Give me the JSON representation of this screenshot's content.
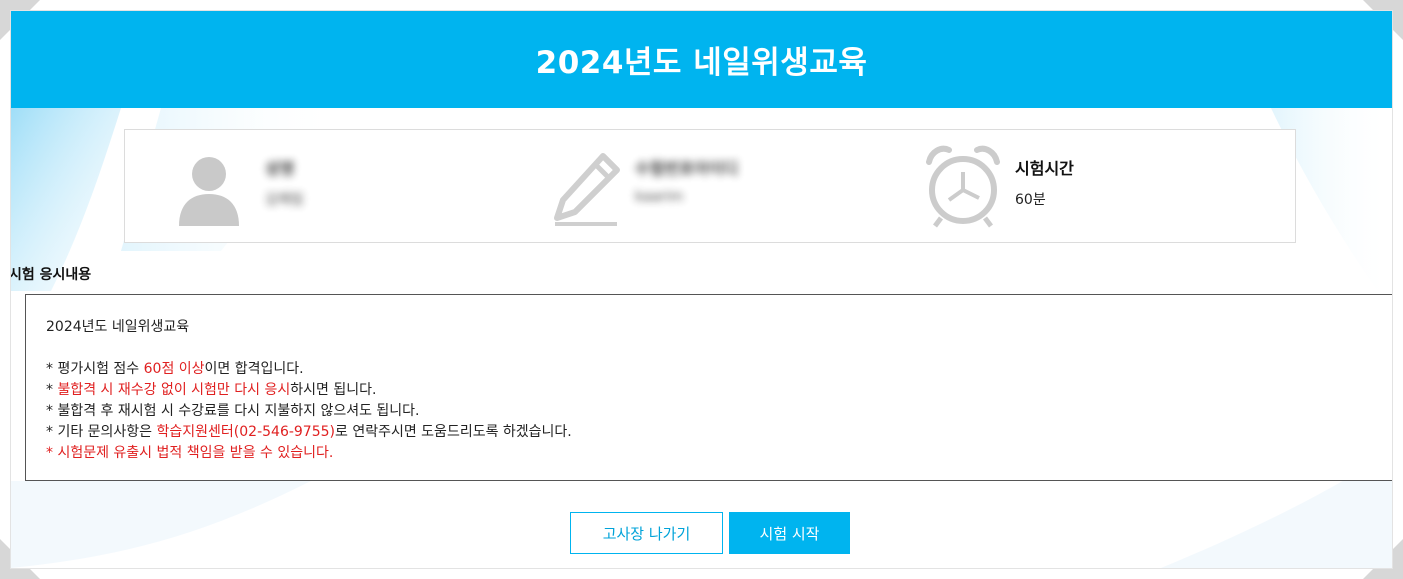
{
  "header": {
    "title": "2024년도 네일위생교육"
  },
  "info": {
    "name_label": "성명",
    "name_value": "김예림",
    "id_label": "수험번호아이디",
    "id_value": "kaarim",
    "time_label": "시험시간",
    "time_value": "60분"
  },
  "section": {
    "title": "시험 응시내용"
  },
  "notice": {
    "heading": "2024년도 네일위생교육",
    "line1": {
      "pre": "* 평가시험 점수 ",
      "red": "60점 이상",
      "post": "이면 합격입니다."
    },
    "line2": {
      "pre": "* ",
      "red": "불합격 시 재수강 없이 시험만 다시 응시",
      "post": "하시면 됩니다."
    },
    "line3": "* 불합격 후 재시험 시 수강료를 다시 지불하지 않으셔도 됩니다.",
    "line4": {
      "pre": "* 기타 문의사항은 ",
      "red": "학습지원센터(02-546-9755)",
      "post": "로 연락주시면 도움드리도록 하겠습니다."
    },
    "line5": "* 시험문제 유출시 법적 책임을 받을 수 있습니다."
  },
  "buttons": {
    "exit": "고사장 나가기",
    "start": "시험 시작"
  },
  "colors": {
    "accent": "#00b4ef",
    "warning": "#e02020"
  },
  "icons": [
    "person-icon",
    "pencil-icon",
    "alarm-clock-icon"
  ]
}
